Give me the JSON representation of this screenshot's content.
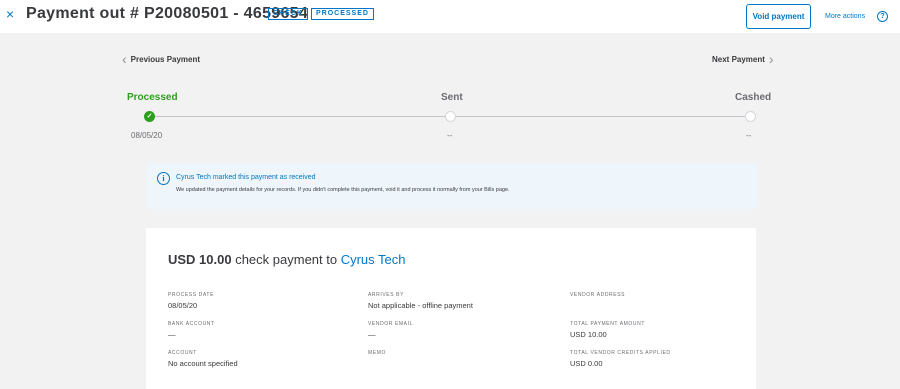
{
  "header": {
    "close_icon": "×",
    "title": "Payment out # P20080501 - 4659654",
    "badges": [
      "CHECK",
      "PROCESSED"
    ],
    "void_label": "Void payment",
    "more_actions_label": "More actions",
    "help_icon": "?"
  },
  "nav": {
    "prev_label": "Previous Payment",
    "next_label": "Next Payment"
  },
  "timeline": {
    "steps": [
      {
        "label": "Processed",
        "date": "08/05/20",
        "status": "complete"
      },
      {
        "label": "Sent",
        "date": "--",
        "status": "pending"
      },
      {
        "label": "Cashed",
        "date": "--",
        "status": "pending"
      }
    ],
    "colors": {
      "complete": "#2ca01c",
      "pending": "#ffffff"
    }
  },
  "notice": {
    "icon": "i",
    "title": "Cyrus Tech marked this payment as received",
    "body": "We updated the payment details for your records. If you didn't complete this payment, void it and process it normally from your Bills page."
  },
  "payment": {
    "amount": "USD 10.00",
    "middle_text": " check payment to ",
    "vendor": "Cyrus Tech",
    "fields": {
      "process_date": {
        "label": "PROCESS DATE",
        "value": "08/05/20"
      },
      "arrives_by": {
        "label": "ARRIVES BY",
        "value": "Not applicable - offline payment"
      },
      "vendor_address": {
        "label": "VENDOR ADDRESS",
        "value": ""
      },
      "bank_account": {
        "label": "BANK ACCOUNT",
        "value": "—"
      },
      "vendor_email": {
        "label": "VENDOR EMAIL",
        "value": "—"
      },
      "total_payment_amount": {
        "label": "TOTAL PAYMENT AMOUNT",
        "value": "USD 10.00"
      },
      "account": {
        "label": "ACCOUNT",
        "value": "No account specified"
      },
      "memo": {
        "label": "MEMO",
        "value": ""
      },
      "total_vendor_credits": {
        "label": "TOTAL VENDOR CREDITS APPLIED",
        "value": "USD 0.00"
      }
    }
  },
  "colors": {
    "accent": "#0077c5",
    "success": "#2ca01c",
    "text": "#393a3d",
    "muted": "#6b6c72"
  }
}
